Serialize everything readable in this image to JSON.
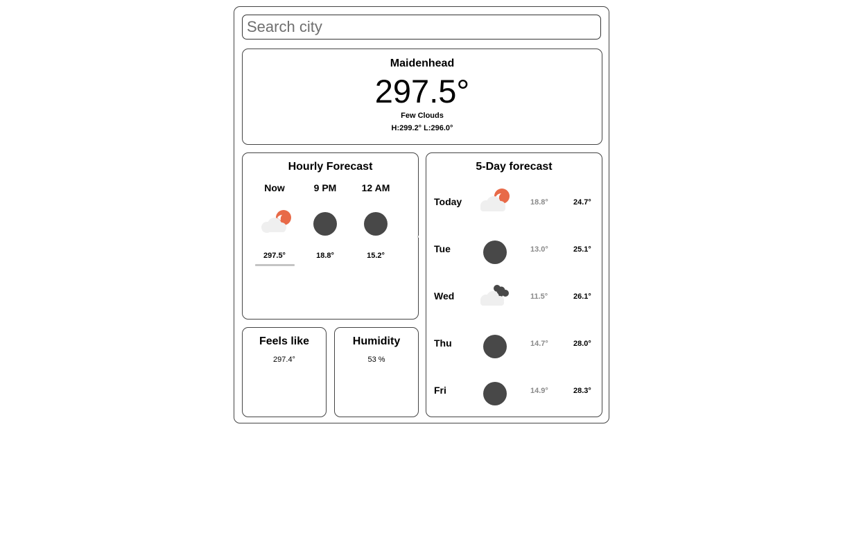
{
  "search": {
    "placeholder": "Search city",
    "value": ""
  },
  "current": {
    "city": "Maidenhead",
    "temperature": "297.5°",
    "condition": "Few Clouds",
    "hilo": "H:299.2° L:296.0°"
  },
  "hourly": {
    "title": "Hourly Forecast",
    "items": [
      {
        "time": "Now",
        "temp": "297.5°",
        "icon": "few-clouds-day-icon",
        "selected": true
      },
      {
        "time": "9 PM",
        "temp": "18.8°",
        "icon": "clear-night-icon"
      },
      {
        "time": "12 AM",
        "temp": "15.2°",
        "icon": "clear-night-icon"
      }
    ]
  },
  "forecast": {
    "title": "5-Day forecast",
    "days": [
      {
        "day": "Today",
        "low": "18.8°",
        "high": "24.7°",
        "icon": "few-clouds-day-icon"
      },
      {
        "day": "Tue",
        "low": "13.0°",
        "high": "25.1°",
        "icon": "clear-night-icon"
      },
      {
        "day": "Wed",
        "low": "11.5°",
        "high": "26.1°",
        "icon": "cloudy-night-icon"
      },
      {
        "day": "Thu",
        "low": "14.7°",
        "high": "28.0°",
        "icon": "clear-night-icon"
      },
      {
        "day": "Fri",
        "low": "14.9°",
        "high": "28.3°",
        "icon": "clear-night-icon"
      }
    ]
  },
  "feels_like": {
    "title": "Feels like",
    "value": "297.4°"
  },
  "humidity": {
    "title": "Humidity",
    "value": "53 %"
  },
  "colors": {
    "sun": "#e86a48",
    "cloud": "#efefef",
    "night": "#484848",
    "muted_text": "#8a8a8a",
    "border": "#444444"
  }
}
